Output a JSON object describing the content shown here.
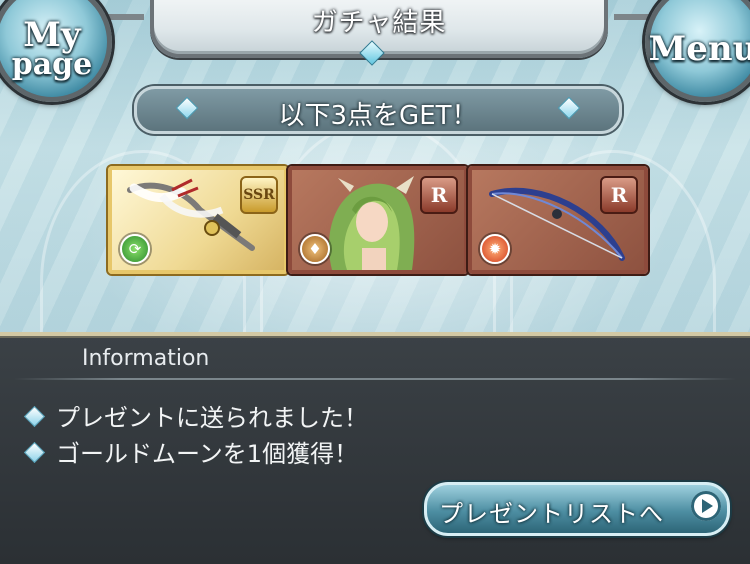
{
  "header": {
    "title": "ガチャ結果",
    "mypage_line1": "My",
    "mypage_line2": "page",
    "menu_label": "Menu"
  },
  "result": {
    "get_text": "以下3点をGET！"
  },
  "items": [
    {
      "rarity": "SSR",
      "element": "wind",
      "element_icon": "wind-icon",
      "kind": "weapon"
    },
    {
      "rarity": "R",
      "element": "earth",
      "element_icon": "earth-icon",
      "kind": "character"
    },
    {
      "rarity": "R",
      "element": "fire",
      "element_icon": "fire-icon",
      "kind": "weapon"
    }
  ],
  "info": {
    "heading": "Information",
    "messages": [
      "プレゼントに送られました！",
      "ゴールドムーンを1個獲得！"
    ],
    "present_button": "プレゼントリストへ"
  },
  "colors": {
    "ssr_frame": "#e7c76a",
    "r_frame": "#8e4b3c",
    "panel_bg": "#2e3236",
    "button_accent": "#4d8ea2"
  }
}
